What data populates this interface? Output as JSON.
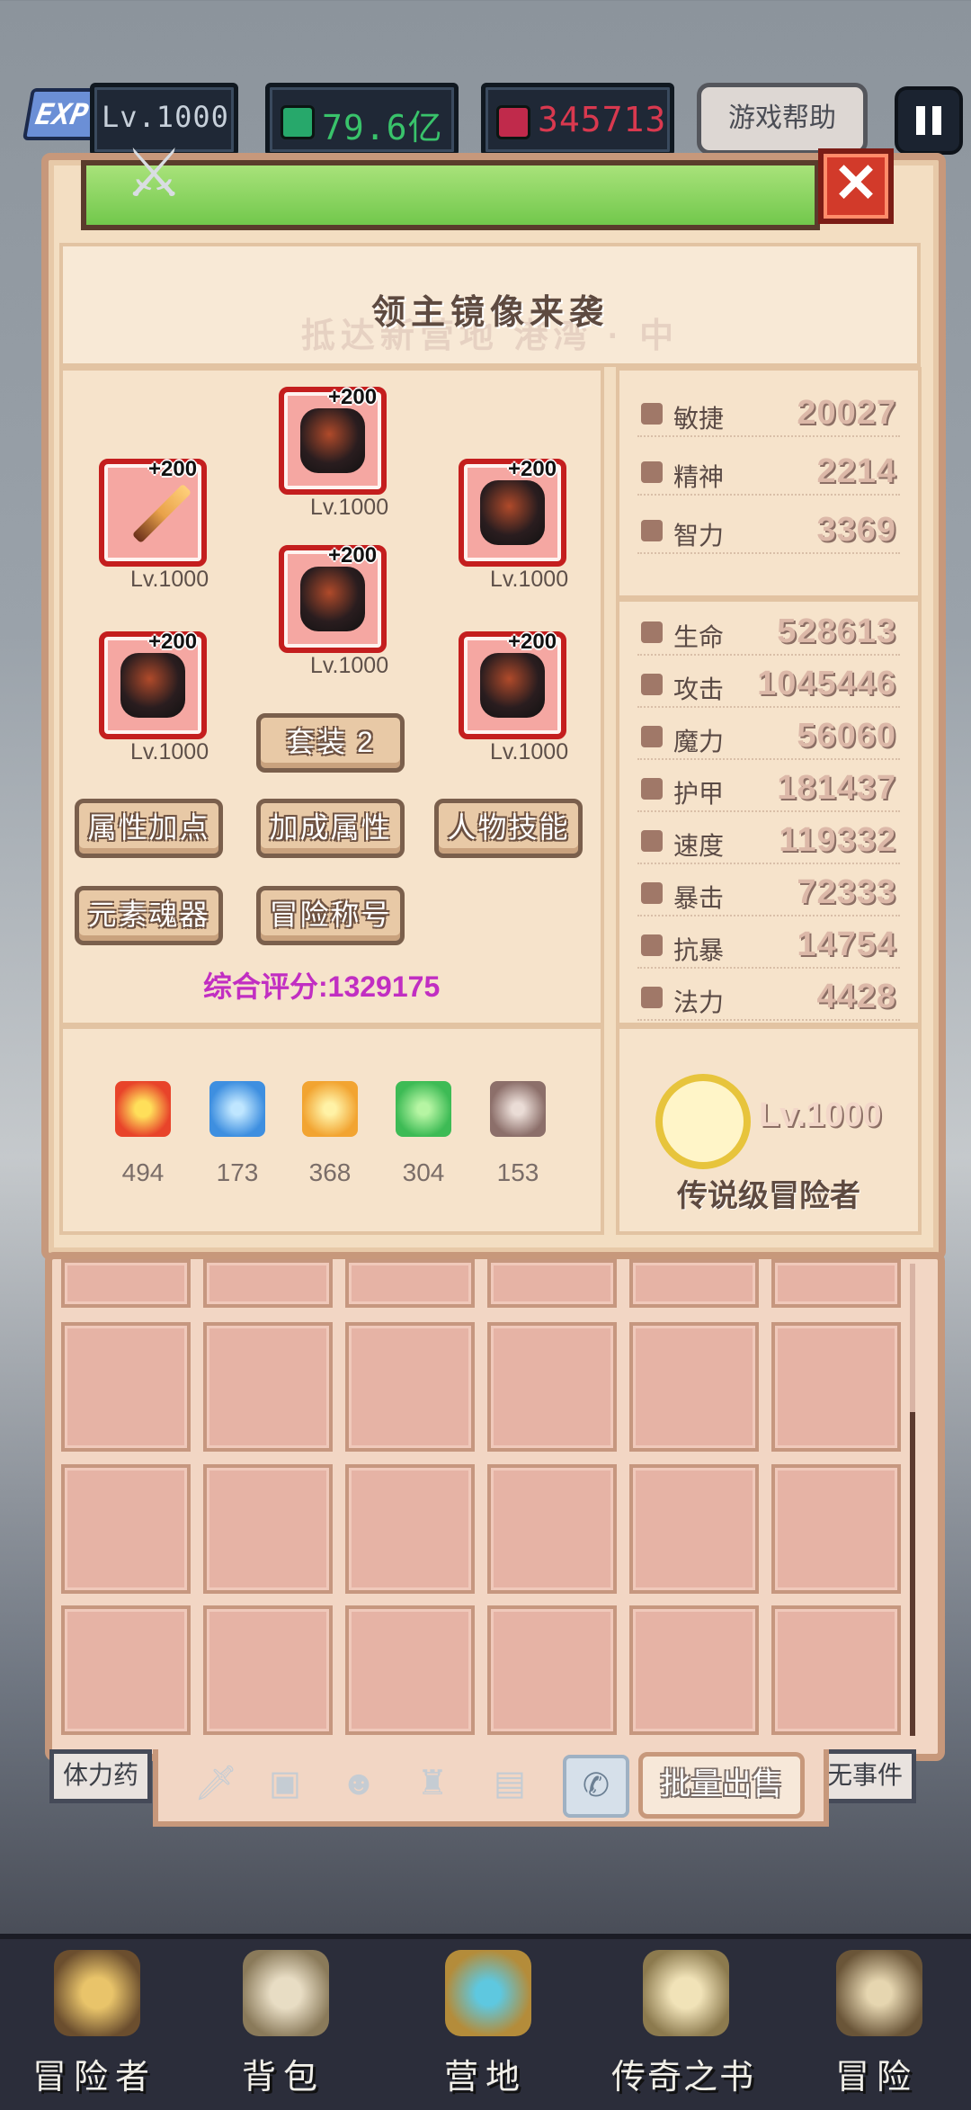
{
  "hud": {
    "exp_label": "EXP",
    "level": "Lv.1000",
    "gold": "79.6亿",
    "gems": "345713",
    "help_button": "游戏帮助"
  },
  "dialog": {
    "title": "领主镜像来袭",
    "subtitle_ghost": "抵达新营地 港湾 · 中"
  },
  "equipment": [
    {
      "slot": "helmet",
      "plus": "+200",
      "level": "Lv.1000"
    },
    {
      "slot": "weapon",
      "plus": "+200",
      "level": "Lv.1000"
    },
    {
      "slot": "shield",
      "plus": "+200",
      "level": "Lv.1000"
    },
    {
      "slot": "armor",
      "plus": "+200",
      "level": "Lv.1000"
    },
    {
      "slot": "gloves",
      "plus": "+200",
      "level": "Lv.1000"
    },
    {
      "slot": "boots",
      "plus": "+200",
      "level": "Lv.1000"
    }
  ],
  "buttons": {
    "set": "套装 2",
    "attr_points": "属性加点",
    "bonus_attr": "加成属性",
    "skills": "人物技能",
    "element_soul": "元素魂器",
    "adventure_title": "冒险称号"
  },
  "score": "综合评分:1329175",
  "elements": [
    {
      "icon": "fire-icon",
      "value": "494",
      "color": "#e8442a"
    },
    {
      "icon": "water-icon",
      "value": "173",
      "color": "#3e8fe0"
    },
    {
      "icon": "lightning-icon",
      "value": "368",
      "color": "#f2a431"
    },
    {
      "icon": "wind-icon",
      "value": "304",
      "color": "#3dbb55"
    },
    {
      "icon": "skull-icon",
      "value": "153",
      "color": "#8c6f6a"
    }
  ],
  "stats_primary": [
    {
      "name": "敏捷",
      "value": "20027"
    },
    {
      "name": "精神",
      "value": "2214"
    },
    {
      "name": "智力",
      "value": "3369"
    }
  ],
  "stats_secondary": [
    {
      "name": "生命",
      "value": "528613"
    },
    {
      "name": "攻击",
      "value": "1045446"
    },
    {
      "name": "魔力",
      "value": "56060"
    },
    {
      "name": "护甲",
      "value": "181437"
    },
    {
      "name": "速度",
      "value": "119332"
    },
    {
      "name": "暴击",
      "value": "72333"
    },
    {
      "name": "抗暴",
      "value": "14754"
    },
    {
      "name": "法力",
      "value": "4428"
    }
  ],
  "rank": {
    "level": "Lv.1000",
    "name": "传说级冒险者"
  },
  "inventory": {
    "side_left": "体力药",
    "side_right": "无事件",
    "sell_button": "批量出售"
  },
  "nav": [
    {
      "label": "冒险者",
      "icon": "adventurer-icon"
    },
    {
      "label": "背包",
      "icon": "backpack-icon"
    },
    {
      "label": "营地",
      "icon": "camp-icon"
    },
    {
      "label": "传奇之书",
      "icon": "legend-book-icon"
    },
    {
      "label": "冒险",
      "icon": "adventure-sword-icon"
    }
  ]
}
